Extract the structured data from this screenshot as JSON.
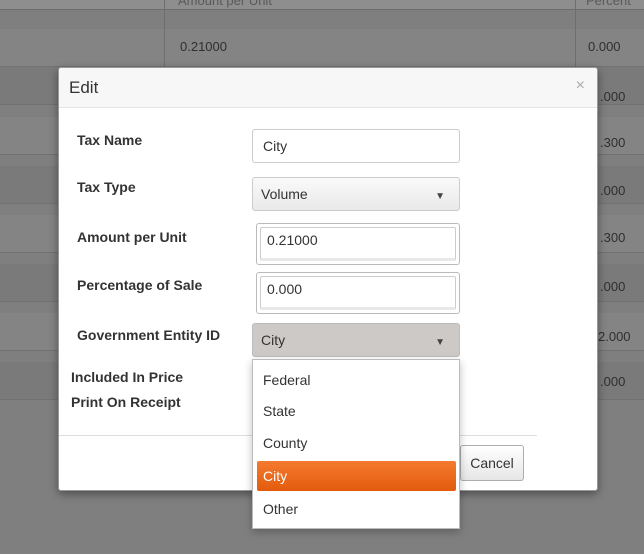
{
  "background_table": {
    "header": {
      "col2": "Amount per Unit",
      "col3": "Percent"
    },
    "rows": [
      {
        "amount": "0.21000",
        "percent": "0.000"
      },
      {
        "amount": "",
        "percent": ".000"
      },
      {
        "amount": "",
        "percent": ".300"
      },
      {
        "amount": "",
        "percent": ".000"
      },
      {
        "amount": "",
        "percent": ".300"
      },
      {
        "amount": "",
        "percent": ".000"
      },
      {
        "amount": "",
        "percent": "2.000"
      },
      {
        "amount": "",
        "percent": ".000"
      }
    ]
  },
  "modal": {
    "title": "Edit",
    "close_glyph": "×",
    "fields": {
      "tax_name": {
        "label": "Tax Name",
        "value": "City"
      },
      "tax_type": {
        "label": "Tax Type",
        "value": "Volume"
      },
      "amount_per_unit": {
        "label": "Amount per Unit",
        "value": "0.21000"
      },
      "percentage_of_sale": {
        "label": "Percentage of Sale",
        "value": "0.000"
      },
      "government_entity_id": {
        "label": "Government Entity ID",
        "value": "City"
      },
      "included_in_price": {
        "label": "Included In Price"
      },
      "print_on_receipt": {
        "label": "Print On Receipt"
      }
    },
    "cancel_label": "Cancel",
    "caret_glyph": "▼",
    "dropdown_options": [
      "Federal",
      "State",
      "County",
      "City",
      "Other"
    ],
    "dropdown_selected": "City"
  },
  "colors": {
    "accent": "#ef6c1e",
    "overlay_background": "#7f7f7f"
  },
  "icons": {
    "close": "close-icon",
    "caret": "chevron-down-icon"
  }
}
